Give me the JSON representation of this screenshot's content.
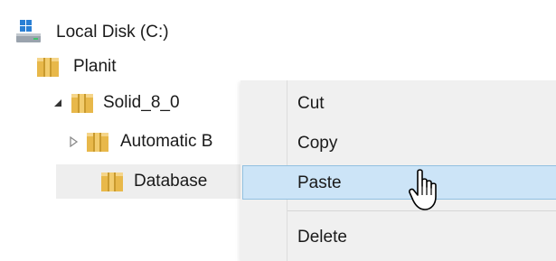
{
  "tree": {
    "items": [
      {
        "label": "Local Disk (C:)",
        "icon": "drive-icon"
      },
      {
        "label": "Planit",
        "icon": "folder-icon"
      },
      {
        "label": "Solid_8_0",
        "icon": "folder-icon",
        "expander": "expanded-arrow-icon"
      },
      {
        "label": "Automatic B",
        "icon": "folder-icon",
        "expander": "collapsed-arrow-icon"
      },
      {
        "label": "Database",
        "icon": "folder-icon",
        "selected": true
      }
    ]
  },
  "context_menu": {
    "items": [
      {
        "label": "Cut"
      },
      {
        "label": "Copy"
      },
      {
        "label": "Paste",
        "highlighted": true
      },
      {
        "label": "Delete"
      }
    ]
  },
  "colors": {
    "folder": "#e8b84a",
    "folder_dark": "#c99a2e",
    "folder_band": "#f5d58a",
    "drive_blue": "#2a7fd4",
    "menu_bg": "#f0f0f0",
    "menu_highlight": "#cce4f7",
    "menu_highlight_border": "#92c0e0",
    "selection_bg": "#eeeeee"
  },
  "cursor": {
    "icon": "hand-pointer-icon"
  }
}
